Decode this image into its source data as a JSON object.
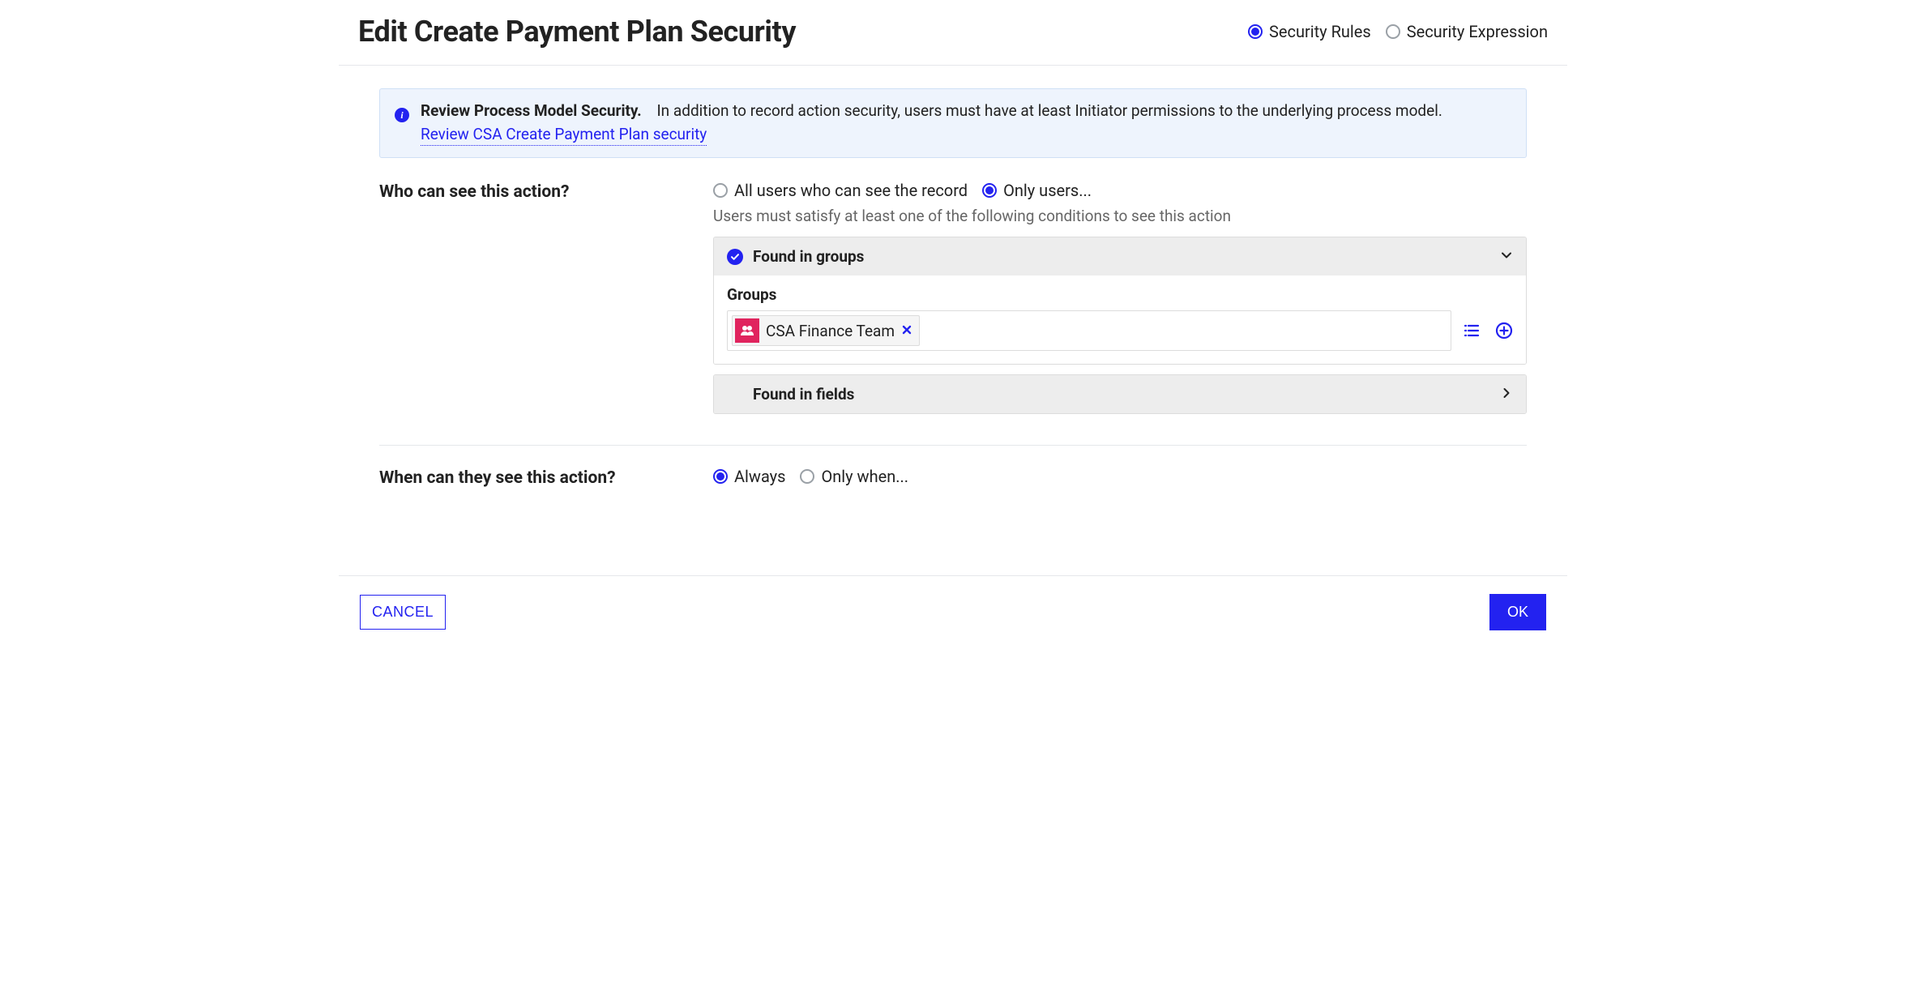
{
  "header": {
    "title": "Edit Create Payment Plan Security",
    "radio_rules": "Security Rules",
    "radio_expression": "Security Expression"
  },
  "info": {
    "title": "Review Process Model Security.",
    "text": "In addition to record action security, users must have at least Initiator permissions to the underlying process model.",
    "link": "Review CSA Create Payment Plan security"
  },
  "who": {
    "label": "Who can see this action?",
    "option_all": "All users who can see the record",
    "option_only": "Only users...",
    "helper": "Users must satisfy at least one of the following conditions to see this action",
    "panel_groups_title": "Found in groups",
    "panel_fields_title": "Found in fields",
    "groups_label": "Groups",
    "group_token": "CSA Finance Team"
  },
  "when": {
    "label": "When can they see this action?",
    "option_always": "Always",
    "option_only_when": "Only when..."
  },
  "footer": {
    "cancel": "CANCEL",
    "ok": "OK"
  },
  "colors": {
    "accent": "#2322f0",
    "pink": "#e0245e"
  }
}
